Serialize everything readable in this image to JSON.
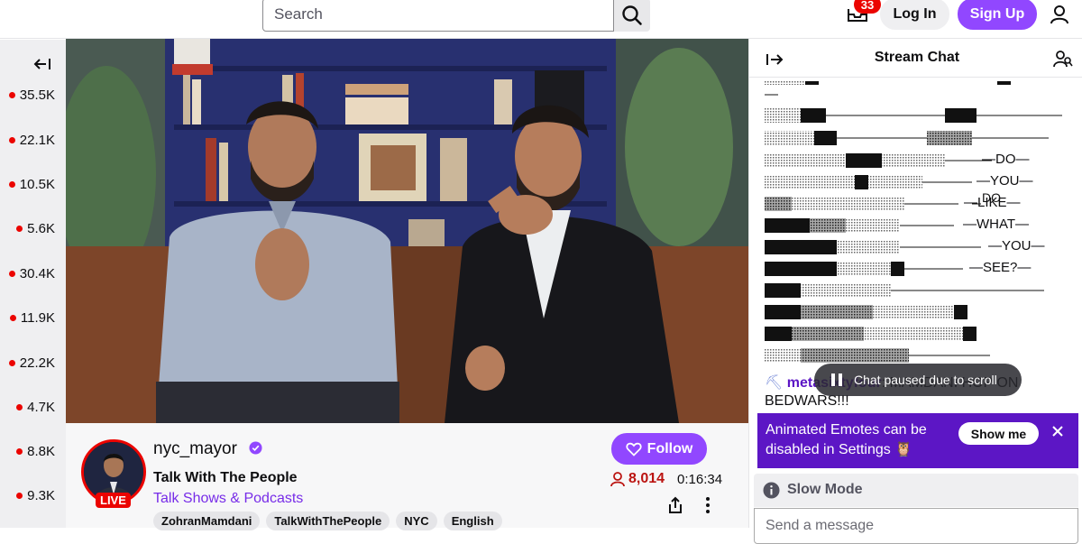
{
  "topbar": {
    "search_placeholder": "Search",
    "notification_count": "33",
    "login_label": "Log In",
    "signup_label": "Sign Up"
  },
  "sidebar": {
    "items": [
      {
        "viewers": "35.5K"
      },
      {
        "viewers": "22.1K"
      },
      {
        "viewers": "10.5K"
      },
      {
        "viewers": "5.6K"
      },
      {
        "viewers": "30.4K"
      },
      {
        "viewers": "11.9K"
      },
      {
        "viewers": "22.2K"
      },
      {
        "viewers": "4.7K"
      },
      {
        "viewers": "8.8K"
      },
      {
        "viewers": "9.3K"
      }
    ]
  },
  "stream": {
    "channel_name": "nyc_mayor",
    "live_label": "LIVE",
    "title": "Talk With The People",
    "category": "Talk Shows & Podcasts",
    "tags": [
      "ZohranMamdani",
      "TalkWithThePeople",
      "NYC",
      "English"
    ],
    "follow_label": "Follow",
    "viewer_count": "8,014",
    "uptime": "0:16:34"
  },
  "chat": {
    "title": "Stream Chat",
    "art_words": [
      "DO",
      "YOU",
      "LIKE",
      "WHAT",
      "YOU",
      "SEE?"
    ],
    "last_message": {
      "user": "metasixtyfour",
      "text": "MAMDANI HOP ON BEDWARS!!!"
    },
    "paused_text": "Chat paused due to scroll",
    "banner_text": "Animated Emotes can be disabled in Settings",
    "show_me_label": "Show me",
    "slow_mode_label": "Slow Mode",
    "input_placeholder": "Send a message"
  },
  "colors": {
    "accent": "#9147ff",
    "live_red": "#eb0400",
    "viewer_red": "#bb1411",
    "banner_purple": "#5c16c5"
  }
}
